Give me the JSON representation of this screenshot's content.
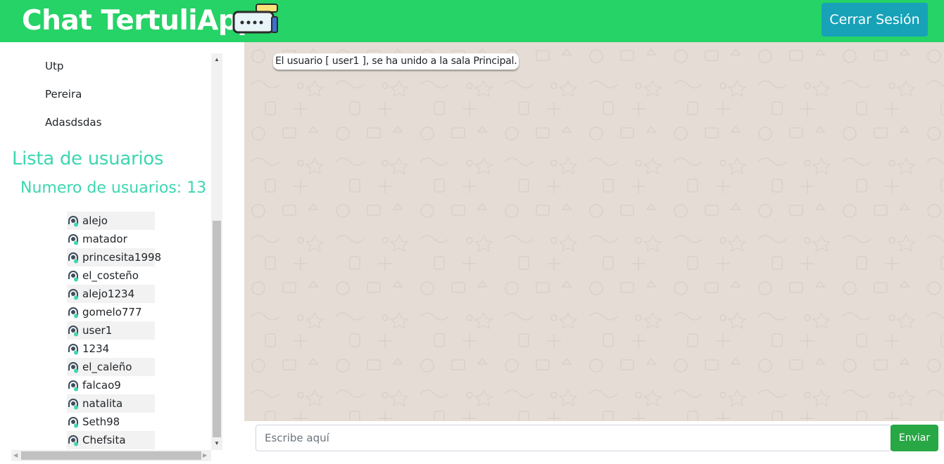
{
  "header": {
    "title": "Chat TertuliApp",
    "logout_label": "Cerrar Sesión"
  },
  "rooms": [
    "Utp",
    "Pereira",
    "Adasdsdas"
  ],
  "users_panel": {
    "title": "Lista de usuarios",
    "count_text": "Numero de usuarios: 13",
    "users": [
      "alejo",
      "matador",
      "princesita1998",
      "el_costeño",
      "alejo1234",
      "gomelo777",
      "user1",
      "1234",
      "el_caleño",
      "falcao9",
      "natalita",
      "Seth98",
      "Chefsita"
    ]
  },
  "chat": {
    "messages": [
      "El usuario [ user1 ], se ha unido a la sala Principal."
    ]
  },
  "composer": {
    "placeholder": "Escribe aquí",
    "send_label": "Enviar"
  },
  "colors": {
    "navbar": "#25d366",
    "logout_button": "#17a2b8",
    "users_title": "#3ed6b1",
    "send_button": "#28a745",
    "chat_background": "#e5ddd5"
  },
  "icons": {
    "logo": "chat-bubble-icon",
    "user": "user-online-icon"
  }
}
